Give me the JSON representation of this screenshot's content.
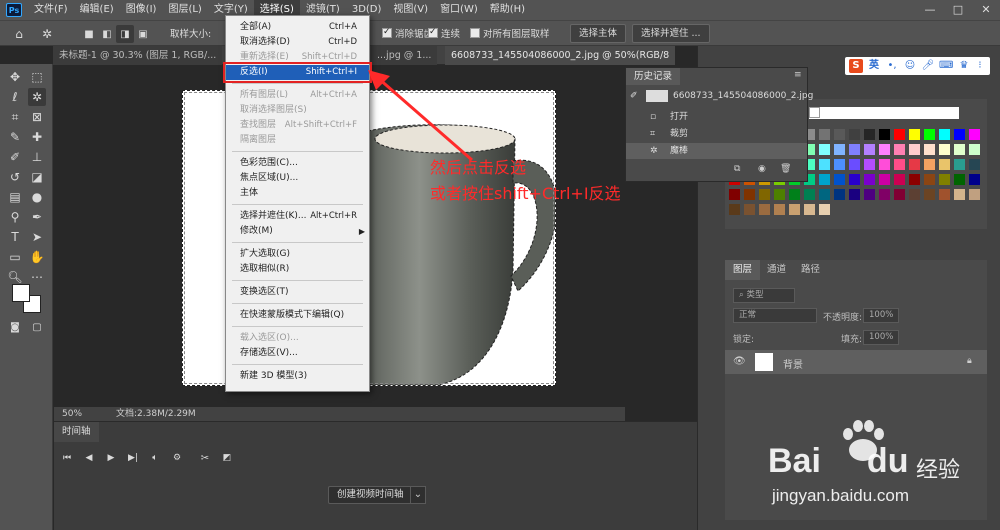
{
  "menubar": {
    "logo": "Ps",
    "items": [
      "文件(F)",
      "编辑(E)",
      "图像(I)",
      "图层(L)",
      "文字(Y)",
      "选择(S)",
      "滤镜(T)",
      "3D(D)",
      "视图(V)",
      "窗口(W)",
      "帮助(H)"
    ],
    "window_controls": [
      "—",
      "□",
      "✕"
    ]
  },
  "options": {
    "sample_size_label": "取样大小:",
    "antialias_label": "消除锯齿",
    "contiguous_label": "连续",
    "sample_all_label": "对所有图层取样",
    "select_subject": "选择主体",
    "select_mask": "选择并遮住 ..."
  },
  "tabs": [
    {
      "label": "未标题-1 @ 30.3% (图层 1, RGB/..."
    },
    {
      "label": "...jpg @ 1..."
    },
    {
      "label": "6608733_145504086000_2.jpg @ 50%(RGB/8"
    }
  ],
  "statusbar": {
    "zoom": "50%",
    "doc": "文档:2.38M/2.29M"
  },
  "timeline": {
    "title": "时间轴",
    "create_video": "创建视频时间轴"
  },
  "select_menu": {
    "items": [
      {
        "label": "全部(A)",
        "shortcut": "Ctrl+A",
        "disabled": false
      },
      {
        "label": "取消选择(D)",
        "shortcut": "Ctrl+D",
        "disabled": false
      },
      {
        "label": "重新选择(E)",
        "shortcut": "Shift+Ctrl+D",
        "disabled": true
      },
      {
        "label": "反选(I)",
        "shortcut": "Shift+Ctrl+I",
        "disabled": false,
        "highlighted": true
      },
      {
        "label": "所有图层(L)",
        "shortcut": "Alt+Ctrl+A",
        "disabled": true
      },
      {
        "label": "取消选择图层(S)",
        "shortcut": "",
        "disabled": true
      },
      {
        "label": "查找图层",
        "shortcut": "Alt+Shift+Ctrl+F",
        "disabled": true
      },
      {
        "label": "隔离图层",
        "shortcut": "",
        "disabled": true
      },
      {
        "label": "色彩范围(C)...",
        "shortcut": "",
        "disabled": false
      },
      {
        "label": "焦点区域(U)...",
        "shortcut": "",
        "disabled": false
      },
      {
        "label": "主体",
        "shortcut": "",
        "disabled": false
      },
      {
        "label": "选择并遮住(K)...",
        "shortcut": "Alt+Ctrl+R",
        "disabled": false
      },
      {
        "label": "修改(M)",
        "shortcut": "",
        "disabled": false,
        "submenu": true
      },
      {
        "label": "扩大选取(G)",
        "shortcut": "",
        "disabled": false
      },
      {
        "label": "选取相似(R)",
        "shortcut": "",
        "disabled": false
      },
      {
        "label": "变换选区(T)",
        "shortcut": "",
        "disabled": false
      },
      {
        "label": "在快速蒙版模式下编辑(Q)",
        "shortcut": "",
        "disabled": false
      },
      {
        "label": "载入选区(O)...",
        "shortcut": "",
        "disabled": true
      },
      {
        "label": "存储选区(V)...",
        "shortcut": "",
        "disabled": false
      },
      {
        "label": "新建 3D 模型(3)",
        "shortcut": "",
        "disabled": false
      }
    ]
  },
  "history": {
    "title": "历史记录",
    "snapshot": "6608733_145504086000_2.jpg",
    "entries": [
      "打开",
      "裁剪",
      "魔棒"
    ]
  },
  "layers": {
    "tabs": [
      "图层",
      "通道",
      "路径"
    ],
    "filter_label": "类型",
    "blend_mode": "正常",
    "opacity_label": "不透明度:",
    "opacity_value": "100%",
    "lock_label": "锁定:",
    "fill_label": "填充:",
    "fill_value": "100%",
    "layer_name": "背景"
  },
  "annotation": {
    "line1": "然后点击反选",
    "line2": "或者按住shift+Ctrl+I反选"
  },
  "watermark": {
    "brand": "Bai",
    "brand2": "du",
    "brand_cn": "经验",
    "url": "jingyan.baidu.com"
  },
  "ime": {
    "label": "英"
  },
  "colors": {
    "highlight": "#1f5fb8",
    "annotation_red": "#ff2a2a",
    "ps_blue": "#31a8ff",
    "swatches_row1": [
      "#ffffff",
      "#f2f2f2",
      "#d9d9d9",
      "#bfbfbf",
      "#a6a6a6",
      "#8c8c8c",
      "#737373",
      "#595959",
      "#404040",
      "#262626",
      "#000000",
      "#ff0000",
      "#ffff00",
      "#00ff00",
      "#00ffff",
      "#0000ff",
      "#ff00ff"
    ],
    "swatches_row2": [
      "#ff8080",
      "#ffb380",
      "#ffff80",
      "#b3ff80",
      "#80ff80",
      "#80ffb3",
      "#80ffff",
      "#80b3ff",
      "#8080ff",
      "#b380ff",
      "#ff80ff",
      "#ff80b3",
      "#ffcccc",
      "#ffe0cc",
      "#ffffcc",
      "#e0ffcc",
      "#ccffcc"
    ],
    "swatches_row3": [
      "#ff4d4d",
      "#ff944d",
      "#ffdb4d",
      "#a3ff4d",
      "#4dff70",
      "#4dffc2",
      "#4de1ff",
      "#4d8fff",
      "#6a4dff",
      "#b44dff",
      "#ff4dd9",
      "#ff4d88",
      "#e63946",
      "#f4a261",
      "#e9c46a",
      "#2a9d8f",
      "#264653"
    ],
    "swatches_row4": [
      "#cc0000",
      "#cc5200",
      "#cc9900",
      "#7acc00",
      "#00cc29",
      "#00cc85",
      "#00a3cc",
      "#0052cc",
      "#2900cc",
      "#7a00cc",
      "#cc00a3",
      "#cc0052",
      "#8b0000",
      "#8b4513",
      "#808000",
      "#006400",
      "#00008b"
    ],
    "swatches_row5": [
      "#800000",
      "#803300",
      "#806600",
      "#4d8000",
      "#00801a",
      "#008052",
      "#006680",
      "#003380",
      "#1a0080",
      "#4d0080",
      "#800066",
      "#800033",
      "#5c4033",
      "#6b4423",
      "#a0522d",
      "#d2b48c",
      "#c0a080"
    ],
    "swatches_row6": [
      "#5a3a1a",
      "#7a5230",
      "#9a6b40",
      "#b08050",
      "#c9a070",
      "#d8b890",
      "#e8d0b0"
    ]
  }
}
